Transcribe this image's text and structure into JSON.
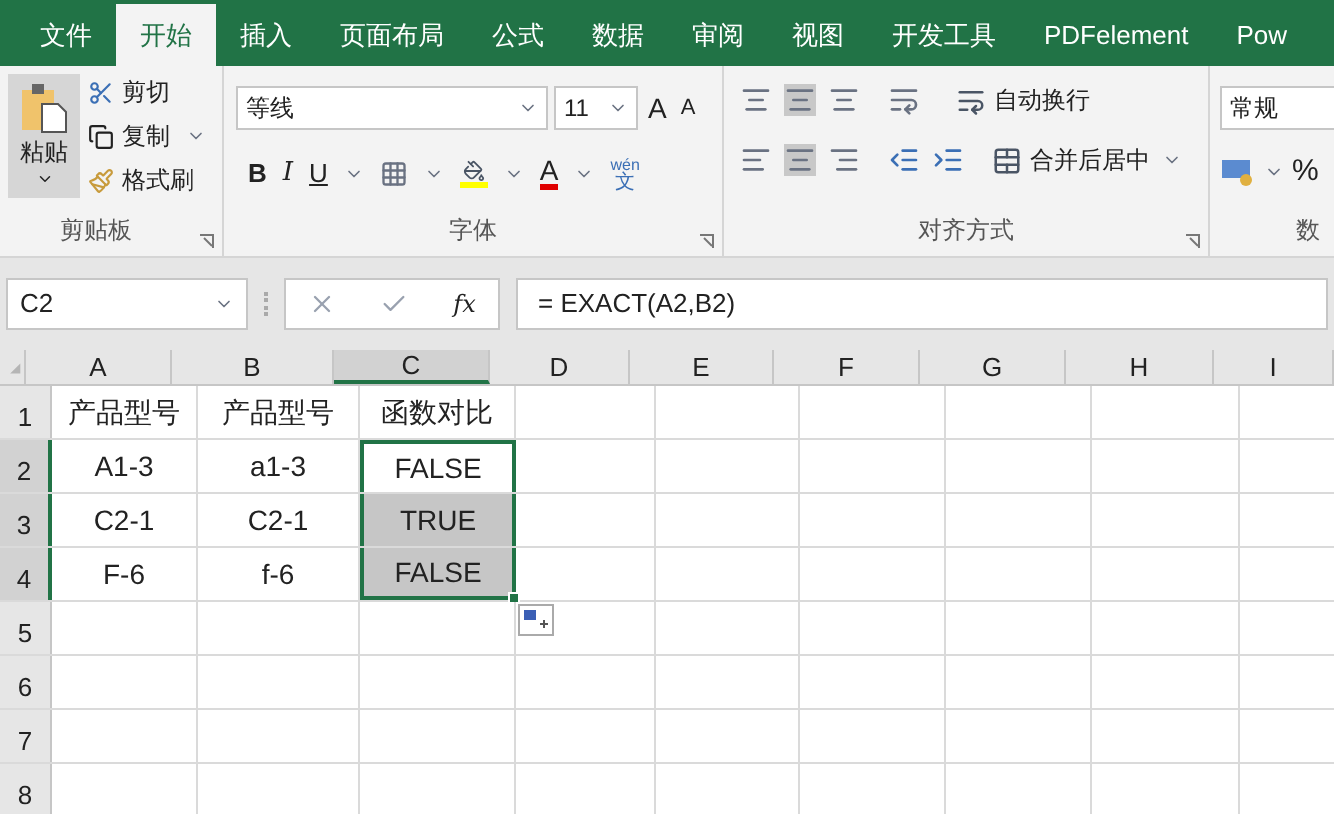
{
  "tabs": [
    {
      "label": "文件",
      "selected": false
    },
    {
      "label": "开始",
      "selected": true
    },
    {
      "label": "插入",
      "selected": false
    },
    {
      "label": "页面布局",
      "selected": false
    },
    {
      "label": "公式",
      "selected": false
    },
    {
      "label": "数据",
      "selected": false
    },
    {
      "label": "审阅",
      "selected": false
    },
    {
      "label": "视图",
      "selected": false
    },
    {
      "label": "开发工具",
      "selected": false
    },
    {
      "label": "PDFelement",
      "selected": false
    },
    {
      "label": "Pow",
      "selected": false
    }
  ],
  "clipboard": {
    "paste": "粘贴",
    "cut": "剪切",
    "copy": "复制",
    "format_painter": "格式刷",
    "label": "剪贴板"
  },
  "font": {
    "name": "等线",
    "size": "11",
    "grow": "A",
    "shrink": "A",
    "bold": "B",
    "italic": "I",
    "underline": "U",
    "font_color": "A",
    "phonetic_top": "wén",
    "phonetic_bottom": "文",
    "label": "字体"
  },
  "alignment": {
    "wrap": "自动换行",
    "merge": "合并后居中",
    "label": "对齐方式"
  },
  "number": {
    "format": "常规",
    "percent": "%",
    "label": "数"
  },
  "formula_bar": {
    "cell_ref": "C2",
    "fx": "fx",
    "formula": "= EXACT(A2,B2)"
  },
  "columns": [
    {
      "label": "A",
      "selected": false
    },
    {
      "label": "B",
      "selected": false
    },
    {
      "label": "C",
      "selected": true
    },
    {
      "label": "D",
      "selected": false
    },
    {
      "label": "E",
      "selected": false
    },
    {
      "label": "F",
      "selected": false
    },
    {
      "label": "G",
      "selected": false
    },
    {
      "label": "H",
      "selected": false
    },
    {
      "label": "I",
      "selected": false
    }
  ],
  "rows": [
    {
      "label": "1",
      "selected": false,
      "cells": [
        {
          "text": "产品型号",
          "selected": false,
          "active": false
        },
        {
          "text": "产品型号",
          "selected": false,
          "active": false
        },
        {
          "text": "函数对比",
          "selected": false,
          "active": false
        }
      ]
    },
    {
      "label": "2",
      "selected": true,
      "cells": [
        {
          "text": "A1-3",
          "selected": false,
          "active": false
        },
        {
          "text": "a1-3",
          "selected": false,
          "active": false
        },
        {
          "text": "FALSE",
          "selected": true,
          "active": true
        }
      ]
    },
    {
      "label": "3",
      "selected": true,
      "cells": [
        {
          "text": "C2-1",
          "selected": false,
          "active": false
        },
        {
          "text": "C2-1",
          "selected": false,
          "active": false
        },
        {
          "text": "TRUE",
          "selected": true,
          "active": false
        }
      ]
    },
    {
      "label": "4",
      "selected": true,
      "cells": [
        {
          "text": "F-6",
          "selected": false,
          "active": false
        },
        {
          "text": "f-6",
          "selected": false,
          "active": false
        },
        {
          "text": "FALSE",
          "selected": true,
          "active": false
        }
      ]
    },
    {
      "label": "5",
      "selected": false,
      "cells": []
    },
    {
      "label": "6",
      "selected": false,
      "cells": []
    },
    {
      "label": "7",
      "selected": false,
      "cells": []
    },
    {
      "label": "8",
      "selected": false,
      "cells": []
    }
  ]
}
